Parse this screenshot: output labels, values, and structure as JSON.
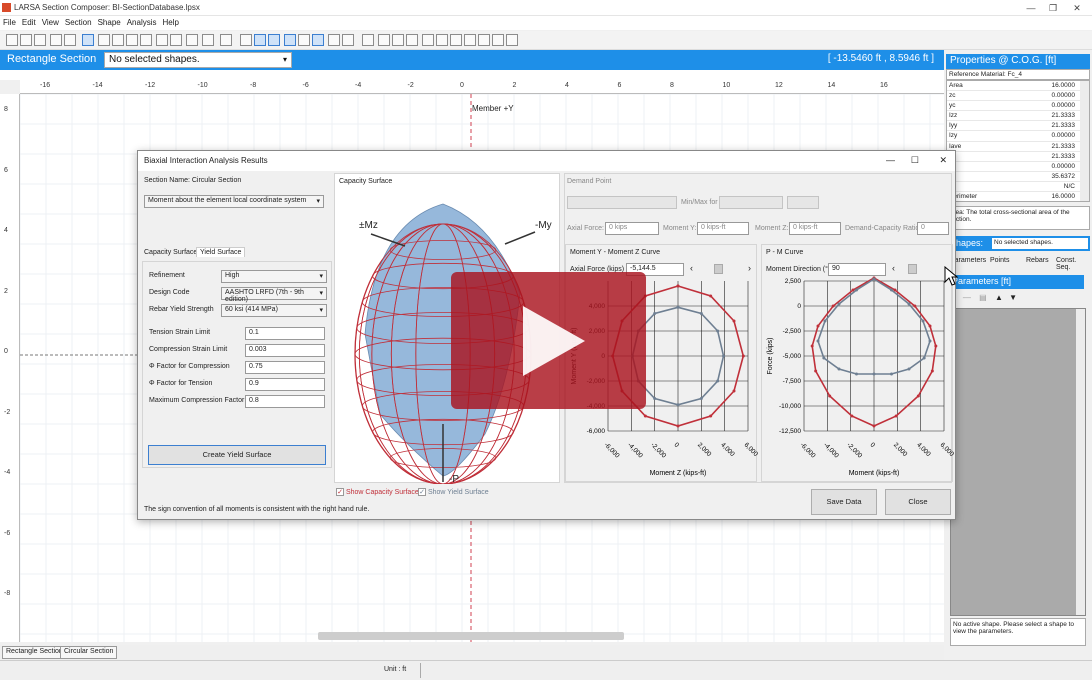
{
  "window": {
    "title": "LARSA Section Composer: BI-SectionDatabase.lpsx"
  },
  "menu": [
    "File",
    "Edit",
    "View",
    "Section",
    "Shape",
    "Analysis",
    "Help"
  ],
  "bluebar": {
    "section_label": "Rectangle Section",
    "shape_select": "No selected shapes.",
    "coords": "[ -13.5460 ft , 8.5946 ft ]"
  },
  "ruler": {
    "top_ticks": [
      "-16",
      "-14",
      "-12",
      "-10",
      "-8",
      "-6",
      "-4",
      "-2",
      "0",
      "2",
      "4",
      "6",
      "8",
      "10",
      "12",
      "14",
      "16"
    ],
    "left_ticks": [
      "8",
      "6",
      "4",
      "2",
      "0",
      "-2",
      "-4",
      "-6",
      "-8"
    ]
  },
  "canvas": {
    "axis_label": "Member +Y"
  },
  "bottom_tabs": [
    "Rectangle Section",
    "Circular Section"
  ],
  "status": {
    "unit": "Unit : ft"
  },
  "right_panel": {
    "properties_title": "Properties @ C.O.G. [ft]",
    "material": "Reference Material: Fc_4",
    "props": [
      {
        "name": "Area",
        "value": "16.0000"
      },
      {
        "name": "zc",
        "value": "0.00000"
      },
      {
        "name": "yc",
        "value": "0.00000"
      },
      {
        "name": "Izz",
        "value": "21.3333"
      },
      {
        "name": "Iyy",
        "value": "21.3333"
      },
      {
        "name": "Izy",
        "value": "0.00000"
      },
      {
        "name": "Iave",
        "value": "21.3333"
      },
      {
        "name": "Ir",
        "value": "21.3333"
      },
      {
        "name": "",
        "value": "0.00000"
      },
      {
        "name": "",
        "value": "35.6372"
      },
      {
        "name": "",
        "value": "N/C"
      },
      {
        "name": "Perimeter",
        "value": "16.0000"
      }
    ],
    "desc": "Area: The total cross-sectional area of the section.",
    "shapes_label": "Shapes:",
    "shapes_select": "No selected shapes.",
    "tabs": [
      "Parameters",
      "Points",
      "Rebars",
      "Const. Seq."
    ],
    "params_title": "Parameters [ft]",
    "no_shape": "No active shape. Please select a shape to view the parameters."
  },
  "dialog": {
    "title": "Biaxial Interaction Analysis Results",
    "section_name": "Section Name: Circular Section",
    "moment_combo": "Moment about the element local coordinate system",
    "tabs": [
      "Capacity Surface",
      "Yield Surface"
    ],
    "fields": [
      {
        "label": "Refinement",
        "value": "High",
        "kind": "combo"
      },
      {
        "label": "Design Code",
        "value": "AASHTO LRFD (7th - 9th edition)",
        "kind": "combo"
      },
      {
        "label": "Rebar Yield Strength",
        "value": "60 ksi (414 MPa)",
        "kind": "combo"
      },
      {
        "label": "Tension Strain Limit",
        "value": "0.1",
        "kind": "text"
      },
      {
        "label": "Compression Strain Limit",
        "value": "0.003",
        "kind": "text"
      },
      {
        "label": "Φ Factor for Compression",
        "value": "0.75",
        "kind": "text"
      },
      {
        "label": "Φ Factor for Tension",
        "value": "0.9",
        "kind": "text"
      },
      {
        "label": "Maximum Compression Factor",
        "value": "0.8",
        "kind": "text"
      }
    ],
    "create_btn": "Create Yield Surface",
    "capacity_surface_label": "Capacity Surface",
    "surface_axes": {
      "mz": "±Mz",
      "my": "-My",
      "p": "-P"
    },
    "show_capacity": "Show Capacity Surface",
    "show_yield": "Show Yield Surface",
    "demand_point": "Demand Point",
    "minmax": "Min/Max for",
    "axial_force_label": "Axial Force:",
    "axial_force_val": "0 kips",
    "moment_y_label": "Moment Y:",
    "moment_y_val": "0 kips-ft",
    "moment_z_label": "Moment Z:",
    "moment_z_val": "0 kips-ft",
    "dcr_label": "Demand-Capacity Ratio",
    "dcr_val": "0",
    "my_mz_title": "Moment Y - Moment Z Curve",
    "axial_kips_label": "Axial Force (kips) :",
    "axial_kips_val": "-5,144.5",
    "pm_title": "P - M Curve",
    "moment_dir_label": "Moment Direction (°):",
    "moment_dir_val": "90",
    "note": "The sign convention of all moments is consistent with the right hand rule.",
    "save_btn": "Save Data",
    "close_btn": "Close"
  },
  "chart_data": [
    {
      "type": "line",
      "title": "Moment Y - Moment Z Curve",
      "xlabel": "Moment Z (kips-ft)",
      "ylabel": "Moment Y (kips-ft)",
      "xticks": [
        "-6,000",
        "-4,000",
        "-2,000",
        "0",
        "2,000",
        "4,000",
        "6,000"
      ],
      "yticks": [
        "4,000",
        "2,000",
        "0",
        "-2,000",
        "-4,000",
        "-6,000"
      ],
      "xlim": [
        -6000,
        6000
      ],
      "ylim": [
        -6000,
        6000
      ],
      "series": [
        {
          "color": "#c0303a",
          "x": [
            0,
            2800,
            4800,
            5600,
            4800,
            2800,
            0,
            -2800,
            -4800,
            -5600,
            -4800,
            -2800,
            0
          ],
          "y": [
            5600,
            4800,
            2800,
            0,
            -2800,
            -4800,
            -5600,
            -4800,
            -2800,
            0,
            2800,
            4800,
            5600
          ]
        },
        {
          "color": "#6e7f92",
          "x": [
            0,
            2000,
            3400,
            3900,
            3400,
            2000,
            0,
            -2000,
            -3400,
            -3900,
            -3400,
            -2000,
            0
          ],
          "y": [
            3900,
            3400,
            2000,
            0,
            -2000,
            -3400,
            -3900,
            -3400,
            -2000,
            0,
            2000,
            3400,
            3900
          ]
        }
      ]
    },
    {
      "type": "line",
      "title": "P - M Curve",
      "xlabel": "Moment (kips-ft)",
      "ylabel": "Force (kips)",
      "xticks": [
        "-6,000",
        "-4,000",
        "-2,000",
        "0",
        "2,000",
        "4,000",
        "6,000"
      ],
      "yticks": [
        "2,500",
        "0",
        "-2,500",
        "-5,000",
        "-7,500",
        "-10,000",
        "-12,500"
      ],
      "xlim": [
        -6000,
        6000
      ],
      "ylim": [
        -12500,
        2500
      ],
      "series": [
        {
          "color": "#c0303a",
          "x": [
            0,
            1800,
            3500,
            4800,
            5300,
            5000,
            3800,
            1900,
            0,
            -1900,
            -3800,
            -5000,
            -5300,
            -4800,
            -3500,
            -1800,
            0
          ],
          "y": [
            2800,
            1600,
            0,
            -2000,
            -4000,
            -6500,
            -9000,
            -11000,
            -12000,
            -11000,
            -9000,
            -6500,
            -4000,
            -2000,
            0,
            1600,
            2800
          ]
        },
        {
          "color": "#6e7f92",
          "x": [
            0,
            1500,
            3000,
            4200,
            4800,
            4300,
            3000,
            1500,
            0,
            -1500,
            -3000,
            -4300,
            -4800,
            -4200,
            -3000,
            -1500,
            0
          ],
          "y": [
            2700,
            1600,
            200,
            -1500,
            -3500,
            -5200,
            -6300,
            -6800,
            -6800,
            -6800,
            -6300,
            -5200,
            -3500,
            -1500,
            200,
            1600,
            2700
          ]
        }
      ]
    }
  ]
}
